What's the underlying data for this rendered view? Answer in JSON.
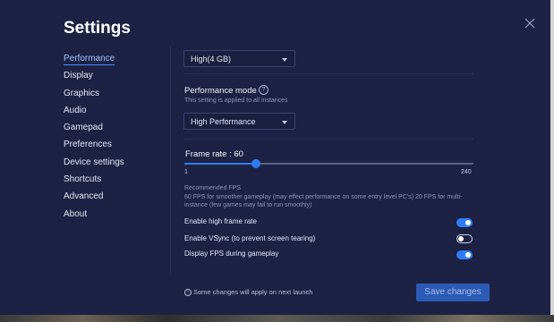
{
  "header": {
    "title": "Settings"
  },
  "nav": {
    "items": [
      {
        "label": "Performance"
      },
      {
        "label": "Display"
      },
      {
        "label": "Graphics"
      },
      {
        "label": "Audio"
      },
      {
        "label": "Gamepad"
      },
      {
        "label": "Preferences"
      },
      {
        "label": "Device settings"
      },
      {
        "label": "Shortcuts"
      },
      {
        "label": "Advanced"
      },
      {
        "label": "About"
      }
    ],
    "active": "Performance"
  },
  "memory": {
    "selected": "High(4 GB)"
  },
  "performance_mode": {
    "title": "Performance mode",
    "subtitle": "This setting is applied to all instances",
    "selected": "High Performance"
  },
  "frame_rate": {
    "label": "Frame rate : 60",
    "min_label": "1",
    "max_label": "240",
    "value": 60,
    "min": 1,
    "max": 240
  },
  "recommended": {
    "title": "Recommended FPS",
    "text": "60 FPS for smoother gameplay (may effect performance on some entry level PC's) 20 FPS for multi-instance (few games may fail to run smoothly)"
  },
  "toggles": [
    {
      "label": "Enable high frame rate",
      "on": true
    },
    {
      "label": "Enable VSync (to prevent screen tearing)",
      "on": false
    },
    {
      "label": "Display FPS during gameplay",
      "on": true
    }
  ],
  "footer": {
    "note": "Some changes will apply on next launch",
    "save_label": "Save changes"
  },
  "colors": {
    "accent": "#2f7cf6",
    "background": "#1d2244"
  }
}
